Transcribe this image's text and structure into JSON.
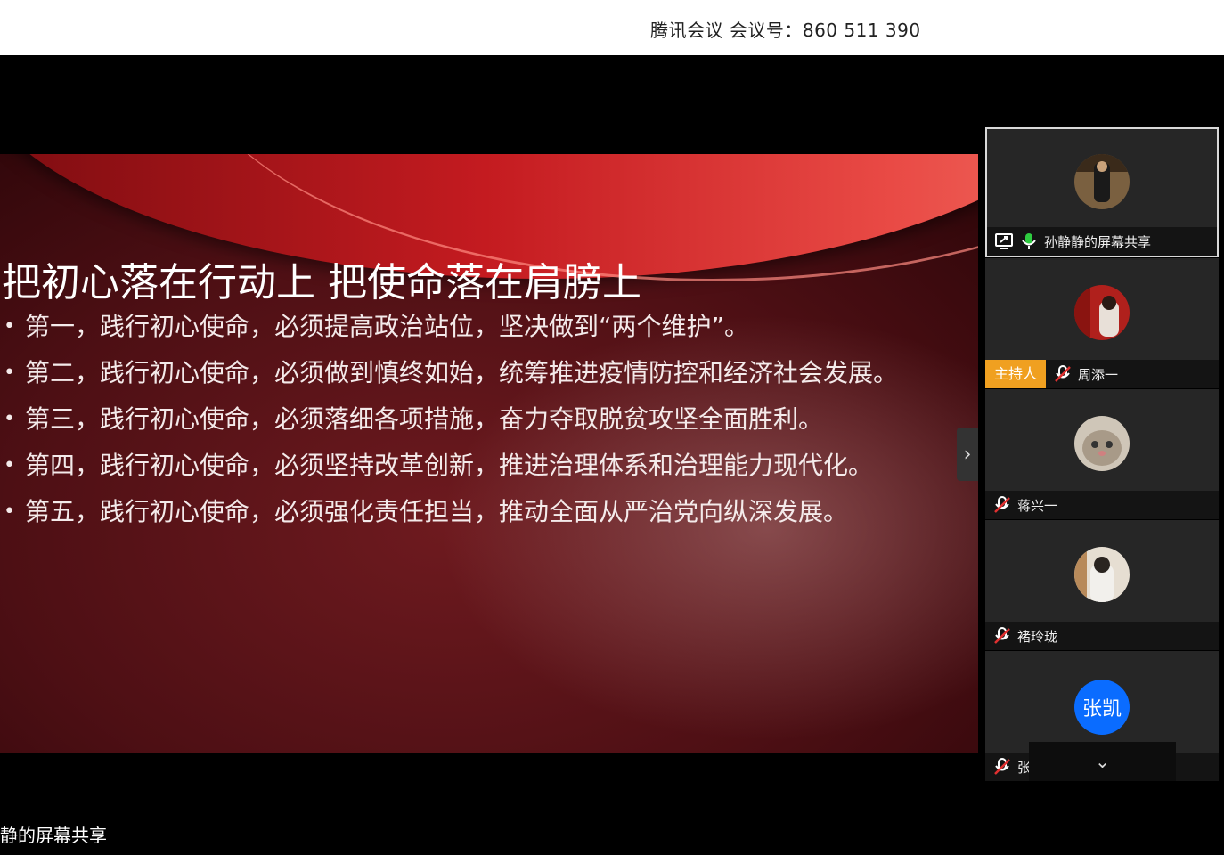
{
  "window": {
    "title": "腾讯会议 会议号：860 511 390"
  },
  "slide": {
    "title": "把初心落在行动上 把使命落在肩膀上",
    "bullets": [
      "第一，践行初心使命，必须提高政治站位，坚决做到“两个维护”。",
      "第二，践行初心使命，必须做到慎终如始，统筹推进疫情防控和经济社会发展。",
      "第三，践行初心使命，必须落细各项措施，奋力夺取脱贫攻坚全面胜利。",
      "第四，践行初心使命，必须坚持改革创新，推进治理体系和治理能力现代化。",
      "第五，践行初心使命，必须强化责任担当，推动全面从严治党向纵深发展。"
    ],
    "bullet_glyph": "•",
    "next_glyph": "›"
  },
  "participants": [
    {
      "name": "孙静静的屏幕共享",
      "mic": "mic-on-icon",
      "sharing": true,
      "avatar": "photo"
    },
    {
      "name": "周添一",
      "mic": "mic-muted-icon",
      "host_badge": "主持人",
      "avatar": "photo"
    },
    {
      "name": "蒋兴一",
      "mic": "mic-muted-icon",
      "avatar": "photo"
    },
    {
      "name": "褚玲珑",
      "mic": "mic-muted-icon",
      "avatar": "photo"
    },
    {
      "name": "张凯",
      "mic": "mic-muted-icon",
      "avatar_text": "张凯"
    }
  ],
  "collapse_glyph": "⌄",
  "share_label": "静的屏幕共享",
  "colors": {
    "host_badge": "#f0a020",
    "avatar_blue": "#0a6cff",
    "mic_on": "#2ecc40"
  }
}
